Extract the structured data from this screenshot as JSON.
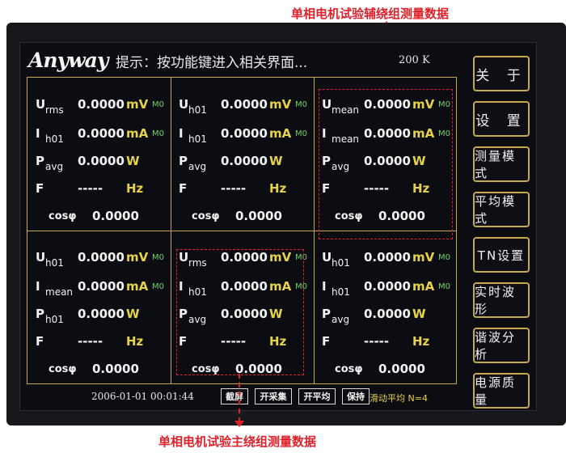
{
  "annotations": {
    "top": "单相电机试验辅绕组测量数据",
    "bottom": "单相电机试验主绕组测量数据"
  },
  "header": {
    "logo": "Anyway",
    "hint": "提示：按功能键进入相关界面...",
    "frequency": "200 K"
  },
  "sidebar": {
    "items": [
      "关 于",
      "设 置",
      "测量模式",
      "平均模式",
      "TN设置",
      "实时波形",
      "谐波分析",
      "电源质量"
    ]
  },
  "panels": [
    {
      "rows": [
        {
          "sym": "U",
          "sub": "rms",
          "val": "0.0000",
          "unit": "mV",
          "rng": "M0"
        },
        {
          "sym": "I",
          "sub": "h01",
          "val": "0.0000",
          "unit": "mA",
          "rng": "M0"
        },
        {
          "sym": "P",
          "sub": "avg",
          "val": "0.0000",
          "unit": "W",
          "rng": ""
        },
        {
          "sym": "F",
          "sub": "",
          "val": "-----",
          "unit": "Hz",
          "rng": ""
        }
      ],
      "cos_label": "cosφ",
      "cos_val": "0.0000"
    },
    {
      "rows": [
        {
          "sym": "U",
          "sub": "h01",
          "val": "0.0000",
          "unit": "mV",
          "rng": "M0"
        },
        {
          "sym": "I",
          "sub": "h01",
          "val": "0.0000",
          "unit": "mA",
          "rng": "M0"
        },
        {
          "sym": "P",
          "sub": "avg",
          "val": "0.0000",
          "unit": "W",
          "rng": ""
        },
        {
          "sym": "F",
          "sub": "",
          "val": "-----",
          "unit": "Hz",
          "rng": ""
        }
      ],
      "cos_label": "cosφ",
      "cos_val": "0.0000"
    },
    {
      "rows": [
        {
          "sym": "U",
          "sub": "mean",
          "val": "0.0000",
          "unit": "mV",
          "rng": "M0"
        },
        {
          "sym": "I",
          "sub": "mean",
          "val": "0.0000",
          "unit": "mA",
          "rng": "M0"
        },
        {
          "sym": "P",
          "sub": "avg",
          "val": "0.0000",
          "unit": "W",
          "rng": ""
        },
        {
          "sym": "F",
          "sub": "",
          "val": "-----",
          "unit": "Hz",
          "rng": ""
        }
      ],
      "cos_label": "cosφ",
      "cos_val": "0.0000"
    },
    {
      "rows": [
        {
          "sym": "U",
          "sub": "h01",
          "val": "0.0000",
          "unit": "mV",
          "rng": "M0"
        },
        {
          "sym": "I",
          "sub": "mean",
          "val": "0.0000",
          "unit": "mA",
          "rng": "M0"
        },
        {
          "sym": "P",
          "sub": "h01",
          "val": "0.0000",
          "unit": "W",
          "rng": ""
        },
        {
          "sym": "F",
          "sub": "",
          "val": "-----",
          "unit": "Hz",
          "rng": ""
        }
      ],
      "cos_label": "cosφ",
      "cos_val": "0.0000"
    },
    {
      "rows": [
        {
          "sym": "U",
          "sub": "rms",
          "val": "0.0000",
          "unit": "mV",
          "rng": "M0"
        },
        {
          "sym": "I",
          "sub": "h01",
          "val": "0.0000",
          "unit": "mA",
          "rng": "M0"
        },
        {
          "sym": "P",
          "sub": "avg",
          "val": "0.0000",
          "unit": "W",
          "rng": ""
        },
        {
          "sym": "F",
          "sub": "",
          "val": "-----",
          "unit": "Hz",
          "rng": ""
        }
      ],
      "cos_label": "cosφ",
      "cos_val": "0.0000"
    },
    {
      "rows": [
        {
          "sym": "U",
          "sub": "h01",
          "val": "0.0000",
          "unit": "mV",
          "rng": "M0"
        },
        {
          "sym": "I",
          "sub": "h01",
          "val": "0.0000",
          "unit": "mA",
          "rng": "M0"
        },
        {
          "sym": "P",
          "sub": "avg",
          "val": "0.0000",
          "unit": "W",
          "rng": ""
        },
        {
          "sym": "F",
          "sub": "",
          "val": "-----",
          "unit": "Hz",
          "rng": ""
        }
      ],
      "cos_label": "cosφ",
      "cos_val": "0.0000"
    }
  ],
  "status": {
    "datetime": "2006-01-01 00:01:44",
    "buttons": [
      "截屏",
      "开采集",
      "开平均",
      "保持"
    ],
    "mode": "滑动平均 N=4"
  },
  "colors": {
    "frame": "#c9a74a",
    "unit": "#e8d24a",
    "range": "#6fd36a",
    "annotation": "#e0202a"
  }
}
